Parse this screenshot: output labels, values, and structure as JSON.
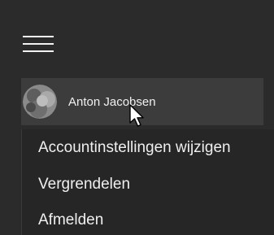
{
  "nav": {
    "menu_icon": "hamburger-icon"
  },
  "user": {
    "name": "Anton Jacobsen",
    "avatar_icon": "avatar"
  },
  "account_menu": {
    "items": [
      {
        "label": "Accountinstellingen wijzigen"
      },
      {
        "label": "Vergrendelen"
      },
      {
        "label": "Afmelden"
      }
    ]
  },
  "colors": {
    "background": "#2b2b2b",
    "tile": "#3c3c3c",
    "menu_background": "#262626",
    "text": "#efefef"
  }
}
